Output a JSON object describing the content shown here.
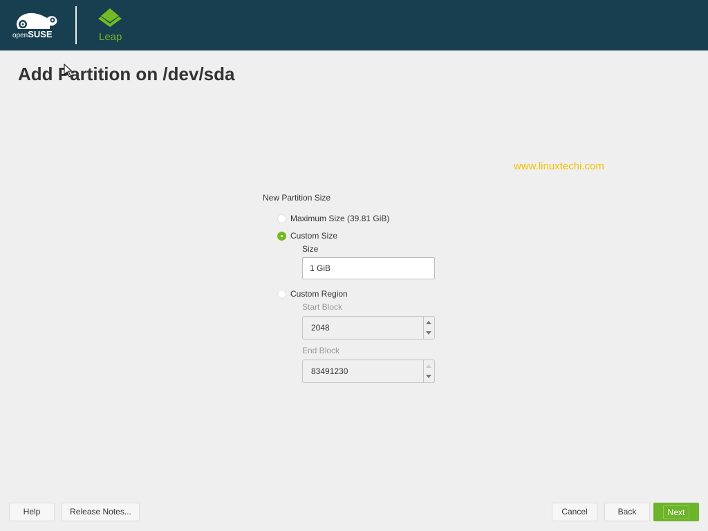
{
  "header": {
    "brand_logo": "openSUSE",
    "brand_text": "openSUSE",
    "product_icon": "leap-layers-icon",
    "product_name": "Leap"
  },
  "page": {
    "title": "Add Partition on /dev/sda",
    "watermark": "www.linuxtechi.com"
  },
  "form": {
    "group_label": "New Partition Size",
    "options": [
      {
        "label": "Maximum Size (39.81 GiB)",
        "selected": false
      },
      {
        "label": "Custom Size",
        "selected": true
      },
      {
        "label": "Custom Region",
        "selected": false
      }
    ],
    "size": {
      "label": "Size",
      "value": "1 GiB"
    },
    "start_block": {
      "label": "Start Block",
      "value": "2048"
    },
    "end_block": {
      "label": "End Block",
      "value": "83491230"
    }
  },
  "footer": {
    "help": "Help",
    "release_notes": "Release Notes...",
    "cancel": "Cancel",
    "back": "Back",
    "next": "Next"
  },
  "colors": {
    "header_bg": "#173f4f",
    "accent_green": "#73ba25",
    "watermark": "#f2c100"
  }
}
